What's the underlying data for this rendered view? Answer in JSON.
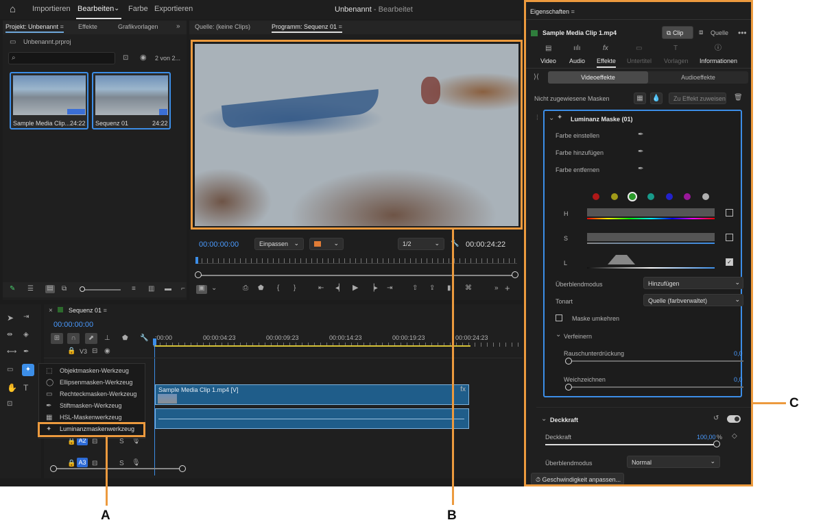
{
  "menu": {
    "items": [
      "Importieren",
      "Bearbeiten",
      "Farbe",
      "Exportieren"
    ],
    "title_main": "Unbenannt",
    "title_sep": " - ",
    "title_sub": "Bearbeitet"
  },
  "project": {
    "tabs": [
      "Projekt: Unbenannt",
      "Effekte",
      "Grafikvorlagen"
    ],
    "file": "Unbenannt.prproj",
    "count": "2 von 2...",
    "items": [
      {
        "name": "Sample Media Clip...",
        "dur": "24:22"
      },
      {
        "name": "Sequenz 01",
        "dur": "24:22"
      }
    ]
  },
  "source": {
    "tab": "Quelle: (keine Clips)"
  },
  "program": {
    "tab": "Programm: Sequenz 01",
    "timecode": "00:00:00:00",
    "fit": "Einpassen",
    "res": "1/2",
    "duration": "00:00:24:22"
  },
  "timeline": {
    "seq": "Sequenz 01",
    "timecode": "00:00:00:00",
    "ruler": [
      ":00:00",
      "00:00:04:23",
      "00:00:09:23",
      "00:00:14:23",
      "00:00:19:23",
      "00:00:24:23"
    ],
    "clip_name": "Sample Media Clip 1.mp4 [V]",
    "tracks": {
      "v3": "V3",
      "a2": "A2",
      "a3": "A3",
      "s": "S"
    }
  },
  "mask_tools": [
    "Objektmasken-Werkzeug",
    "Ellipsenmasken-Werkzeug",
    "Rechteckmasken-Werkzeug",
    "Stiftmasken-Werkzeug",
    "HSL-Maskenwerkzeug",
    "Luminanzmaskenwerkzeug"
  ],
  "props": {
    "title": "Eigenschaften",
    "clip": "Sample Media Clip 1.mp4",
    "btn_clip": "Clip",
    "btn_source": "Quelle",
    "tabs": [
      "Video",
      "Audio",
      "Effekte",
      "Untertitel",
      "Vorlagen",
      "Informationen"
    ],
    "seg": [
      "Videoeffekte",
      "Audioeffekte"
    ],
    "unassigned": "Nicht zugewiesene Masken",
    "assign": "Zu Effekt zuweisen",
    "mask_title": "Luminanz Maske (01)",
    "color_rows": [
      "Farbe einstellen",
      "Farbe hinzufügen",
      "Farbe entfernen"
    ],
    "swatches": [
      "#b01818",
      "#a09a18",
      "#2a9a2a",
      "#189a8a",
      "#2222cc",
      "#9a189a",
      "#b0b0b0"
    ],
    "hsl": [
      "H",
      "S",
      "L"
    ],
    "blend_label": "Überblendmodus",
    "blend_value": "Hinzufügen",
    "tone_label": "Tonart",
    "tone_value": "Quelle (farbverwaltet)",
    "invert": "Maske umkehren",
    "refine": "Verfeinern",
    "noise": "Rauschunterdrückung",
    "noise_val": "0,0",
    "soft": "Weichzeichnen",
    "soft_val": "0,0",
    "opacity_title": "Deckkraft",
    "opacity_label": "Deckkraft",
    "opacity_val": "100,00",
    "opacity_unit": "%",
    "blend2_label": "Überblendmodus",
    "blend2_value": "Normal",
    "speed": "Geschwindigkeit anpassen..."
  },
  "callouts": {
    "a": "A",
    "b": "B",
    "c": "C"
  }
}
